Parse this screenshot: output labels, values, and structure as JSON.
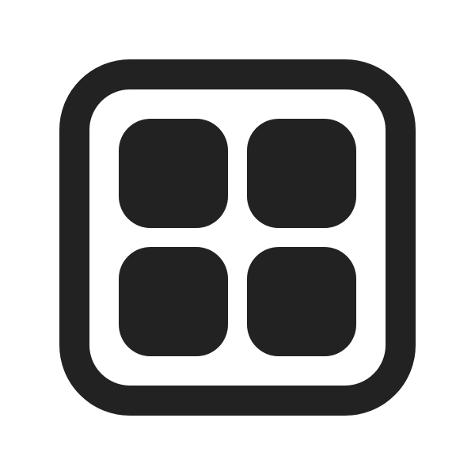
{
  "icon": {
    "name": "apps-grid-icon",
    "glyph_color": "#222222",
    "background_color": "#ffffff",
    "tile_count": 4
  }
}
